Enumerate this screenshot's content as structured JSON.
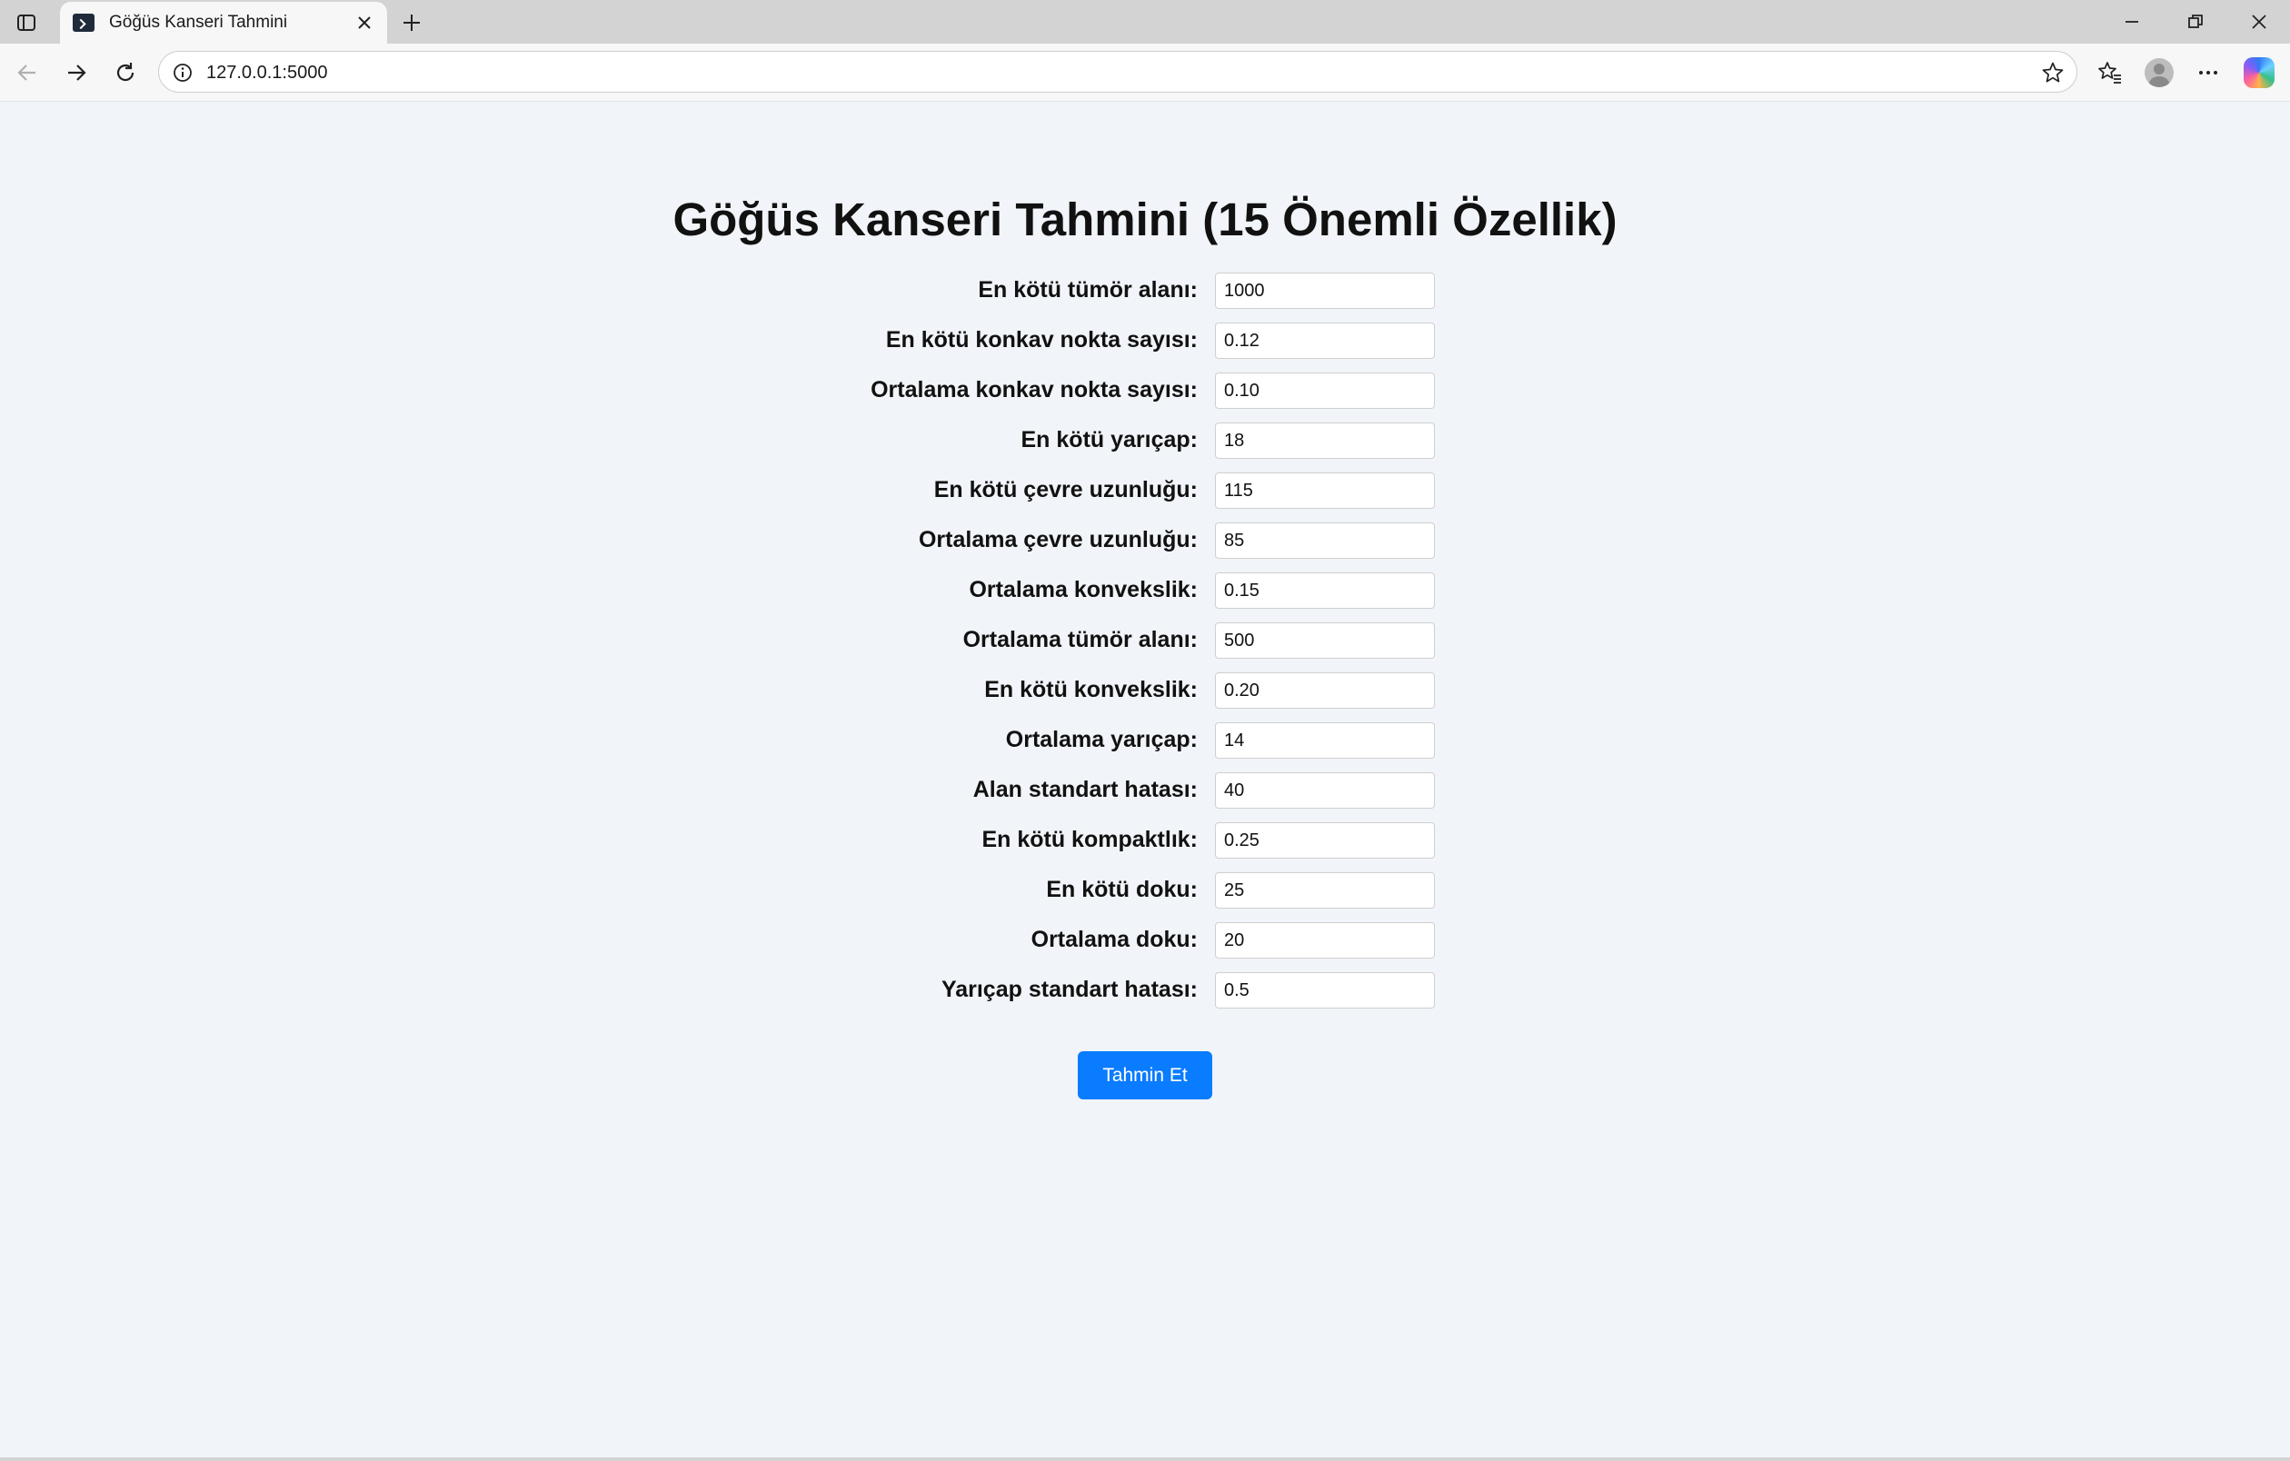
{
  "browser": {
    "tab_title": "Göğüs Kanseri Tahmini",
    "url": "127.0.0.1:5000",
    "icons": {
      "tab_actions": "tab-actions-icon",
      "close_tab": "close-icon",
      "new_tab": "plus-icon",
      "minimize": "minimize-icon",
      "restore": "restore-icon",
      "close_window": "close-icon",
      "back": "back-arrow-icon",
      "forward": "forward-arrow-icon",
      "reload": "reload-icon",
      "site_info": "info-icon",
      "favorite": "star-icon",
      "favorites": "favorites-icon",
      "profile": "avatar",
      "more": "more-icon",
      "copilot": "copilot-icon"
    }
  },
  "page": {
    "title": "Göğüs Kanseri Tahmini (15 Önemli Özellik)",
    "fields": [
      {
        "label": "En kötü tümör alanı:",
        "value": "1000"
      },
      {
        "label": "En kötü konkav nokta sayısı:",
        "value": "0.12"
      },
      {
        "label": "Ortalama konkav nokta sayısı:",
        "value": "0.10"
      },
      {
        "label": "En kötü yarıçap:",
        "value": "18"
      },
      {
        "label": "En kötü çevre uzunluğu:",
        "value": "115"
      },
      {
        "label": "Ortalama çevre uzunluğu:",
        "value": "85"
      },
      {
        "label": "Ortalama konvekslik:",
        "value": "0.15"
      },
      {
        "label": "Ortalama tümör alanı:",
        "value": "500"
      },
      {
        "label": "En kötü konvekslik:",
        "value": "0.20"
      },
      {
        "label": "Ortalama yarıçap:",
        "value": "14"
      },
      {
        "label": "Alan standart hatası:",
        "value": "40"
      },
      {
        "label": "En kötü kompaktlık:",
        "value": "0.25"
      },
      {
        "label": "En kötü doku:",
        "value": "25"
      },
      {
        "label": "Ortalama doku:",
        "value": "20"
      },
      {
        "label": "Yarıçap standart hatası:",
        "value": "0.5"
      }
    ],
    "submit_label": "Tahmin Et",
    "accent_color": "#0a7cff",
    "background_color": "#f1f4f8"
  }
}
